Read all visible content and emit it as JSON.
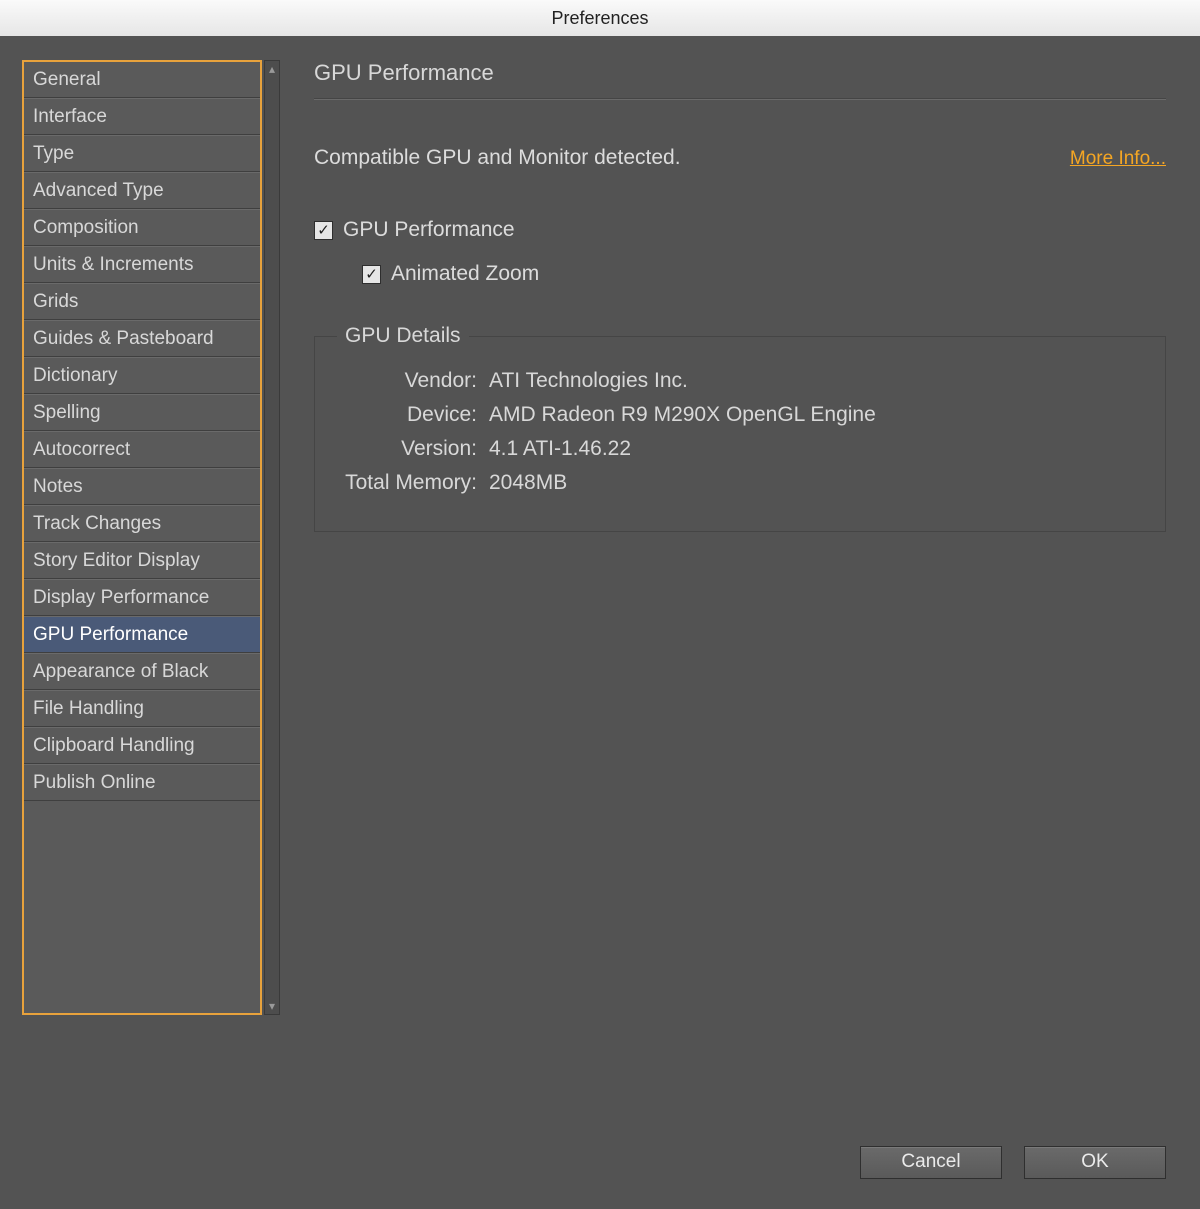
{
  "window": {
    "title": "Preferences"
  },
  "sidebar": {
    "items": [
      {
        "label": "General"
      },
      {
        "label": "Interface"
      },
      {
        "label": "Type"
      },
      {
        "label": "Advanced Type"
      },
      {
        "label": "Composition"
      },
      {
        "label": "Units & Increments"
      },
      {
        "label": "Grids"
      },
      {
        "label": "Guides & Pasteboard"
      },
      {
        "label": "Dictionary"
      },
      {
        "label": "Spelling"
      },
      {
        "label": "Autocorrect"
      },
      {
        "label": "Notes"
      },
      {
        "label": "Track Changes"
      },
      {
        "label": "Story Editor Display"
      },
      {
        "label": "Display Performance"
      },
      {
        "label": "GPU Performance"
      },
      {
        "label": "Appearance of Black"
      },
      {
        "label": "File Handling"
      },
      {
        "label": "Clipboard Handling"
      },
      {
        "label": "Publish Online"
      }
    ],
    "selected_index": 15
  },
  "pane": {
    "title": "GPU Performance",
    "status": "Compatible GPU and Monitor detected.",
    "more_info": "More Info...",
    "checks": {
      "gpu_perf": {
        "label": "GPU Performance",
        "checked": true
      },
      "anim_zoom": {
        "label": "Animated Zoom",
        "checked": true
      }
    },
    "details": {
      "legend": "GPU Details",
      "rows": [
        {
          "k": "Vendor:",
          "v": "ATI Technologies Inc."
        },
        {
          "k": "Device:",
          "v": "AMD Radeon R9 M290X OpenGL Engine"
        },
        {
          "k": "Version:",
          "v": "4.1 ATI-1.46.22"
        },
        {
          "k": "Total Memory:",
          "v": "2048MB"
        }
      ]
    }
  },
  "footer": {
    "cancel": "Cancel",
    "ok": "OK"
  },
  "glyphs": {
    "check": "✓",
    "up": "▴",
    "down": "▾"
  }
}
